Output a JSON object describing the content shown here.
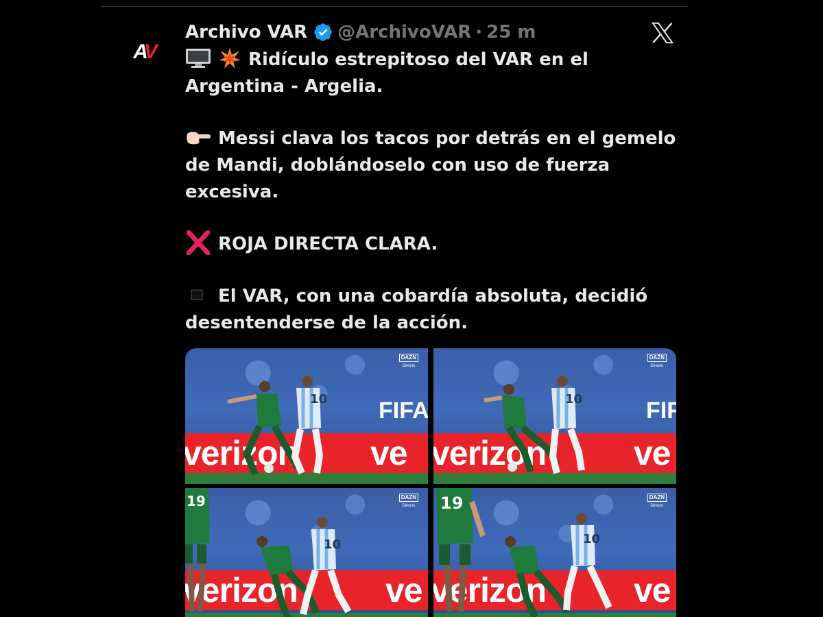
{
  "author": {
    "display_name": "Archivo VAR",
    "handle": "@ArchivoVAR",
    "separator": "·",
    "time": "25 m",
    "avatar_letters": "AV"
  },
  "icons": {
    "verified": "verified-badge-icon",
    "platform": "x-logo-icon",
    "tv": "television-emoji",
    "collision": "collision-emoji",
    "pointing": "pointing-right-emoji",
    "cross": "cross-mark-emoji",
    "square": "black-square-emoji"
  },
  "colors": {
    "background": "#000000",
    "text": "#e7e9ea",
    "muted": "#71767b",
    "verified_blue": "#1d9bf0",
    "cross_red": "#e0245e",
    "avatar_red": "#e3262b"
  },
  "tweet": {
    "line1": "Ridículo estrepitoso del VAR en el",
    "line2": "Argentina - Argelia.",
    "para2": "Messi clava los tacos por detrás en el gemelo de Mandi, doblándoselo con uso de fuerza excesiva.",
    "para3": "ROJA DIRECTA CLARA.",
    "para4": "El VAR, con una cobardía absoluta, decidió desentenderse de la acción."
  },
  "media": {
    "board_text": "verizon",
    "board_text_partial": "ve",
    "fifa_text": "FIFA",
    "broadcaster": "DAZN",
    "broadcaster_sub": "Directo",
    "shirt_number_white": "10",
    "shirt_number_green": "19"
  }
}
